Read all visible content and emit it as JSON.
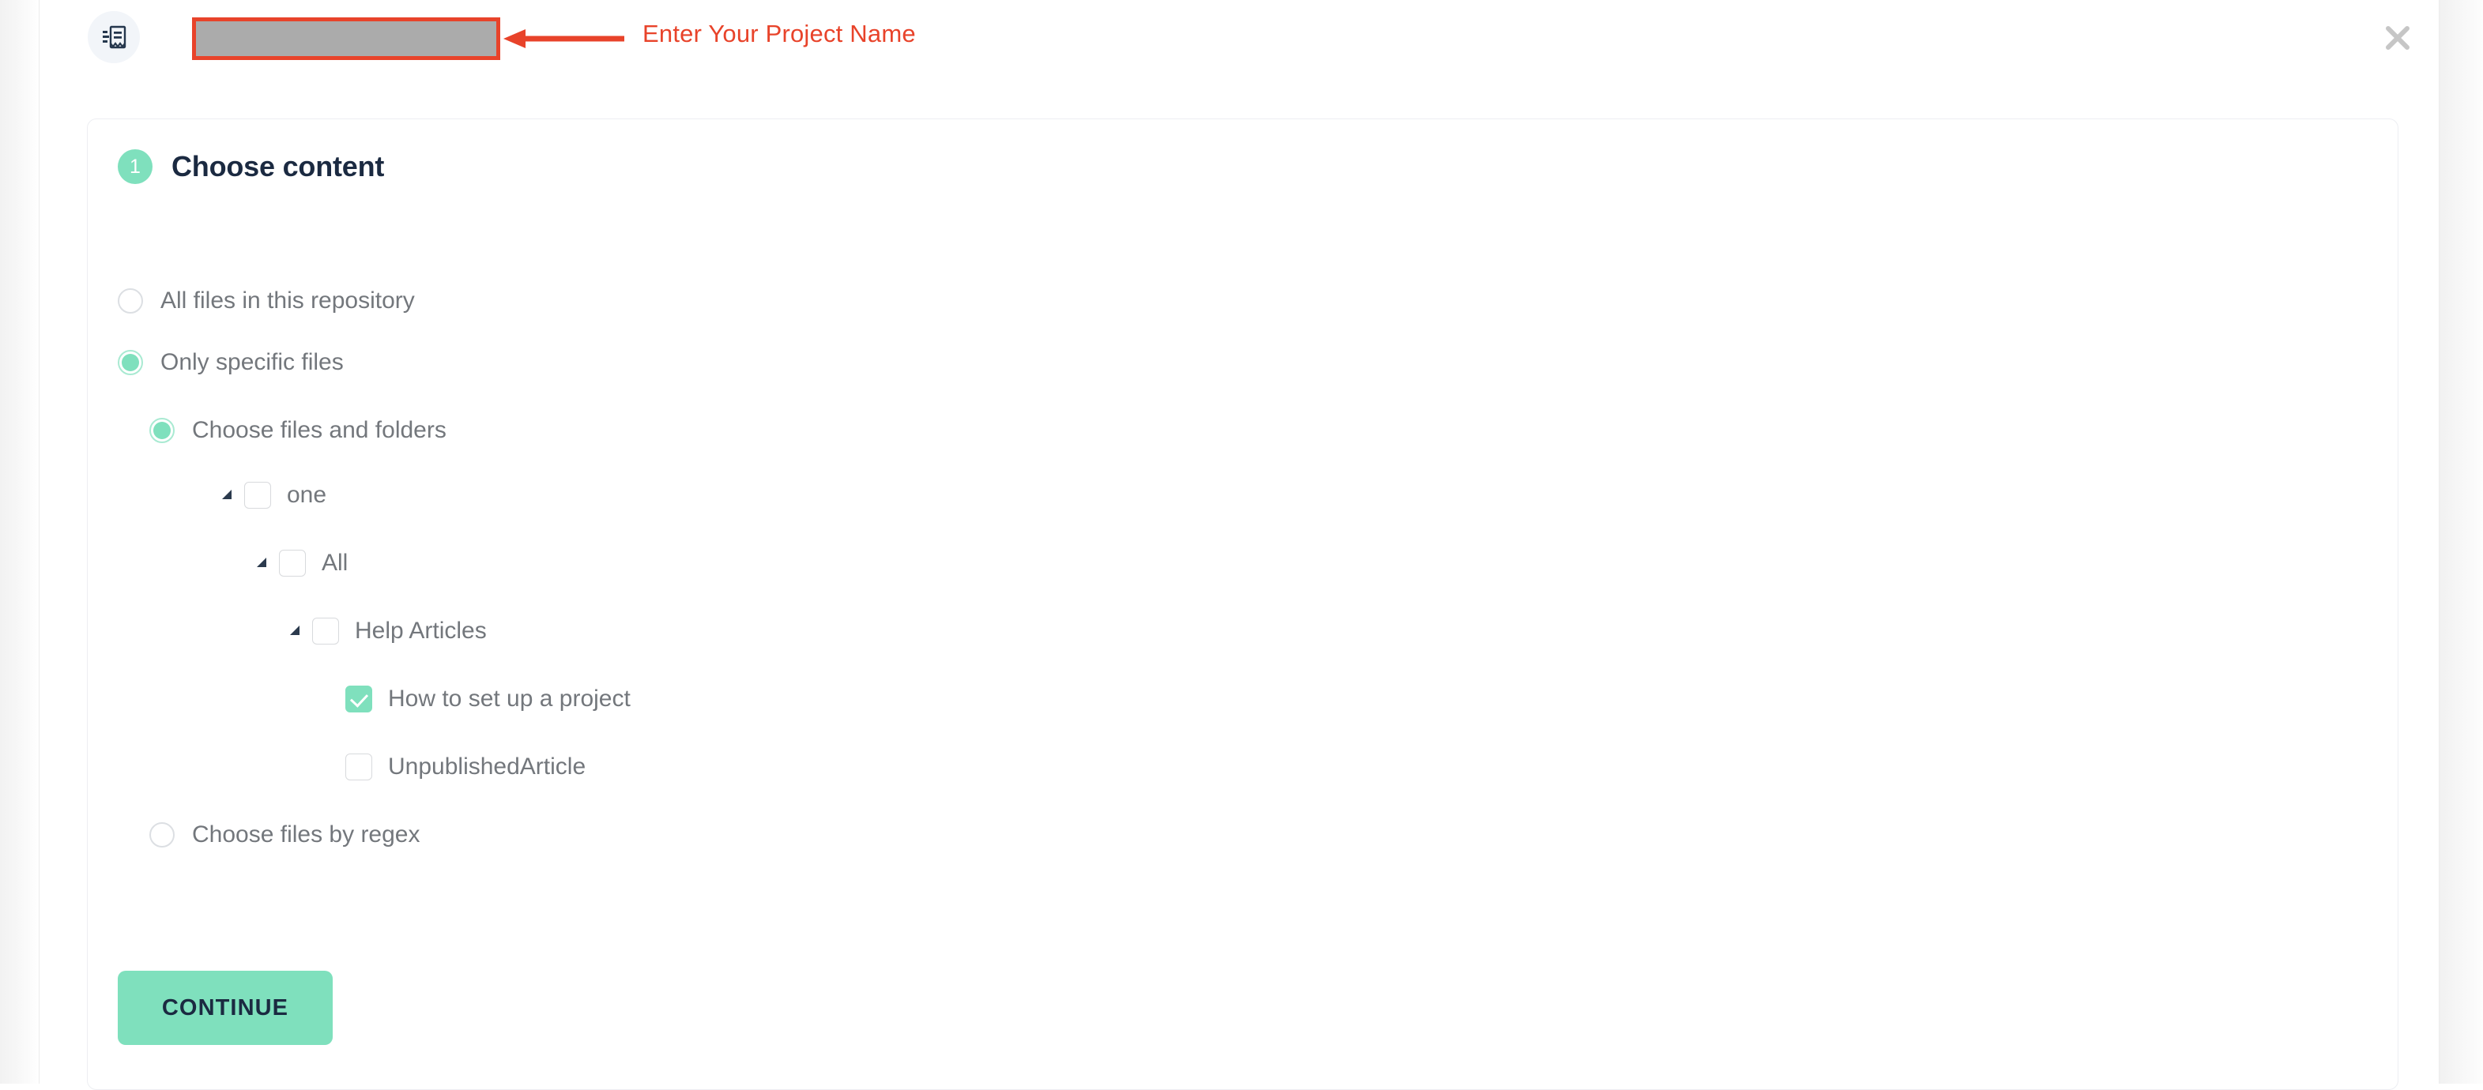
{
  "topbar": {
    "doc_icon": "receipt-document-icon",
    "project_name_value": "",
    "project_name_placeholder": "",
    "close_icon": "close-icon",
    "annotation": {
      "text": "Enter Your Project Name",
      "color": "#e8432a",
      "arrow_icon": "left-arrow-icon"
    }
  },
  "card": {
    "step": {
      "number": "1",
      "title": "Choose content",
      "badge_color": "#7fe0bd"
    },
    "options": [
      {
        "label": "All files in this repository",
        "selected": false
      },
      {
        "label": "Only specific files",
        "selected": true
      }
    ],
    "sub_options": {
      "files_and_folders": {
        "label": "Choose files and folders",
        "selected": true
      },
      "by_regex": {
        "label": "Choose files by regex",
        "selected": false
      }
    },
    "tree": [
      {
        "label": "one",
        "checked": false,
        "expanded": true,
        "depth": 0
      },
      {
        "label": "All",
        "checked": false,
        "expanded": true,
        "depth": 1
      },
      {
        "label": "Help Articles",
        "checked": false,
        "expanded": true,
        "depth": 2
      },
      {
        "label": "How to set up a project",
        "checked": true,
        "expanded": false,
        "depth": 3
      },
      {
        "label": "UnpublishedArticle",
        "checked": false,
        "expanded": false,
        "depth": 3
      }
    ],
    "continue_label": "CONTINUE",
    "accent_color": "#7fe0bd"
  }
}
